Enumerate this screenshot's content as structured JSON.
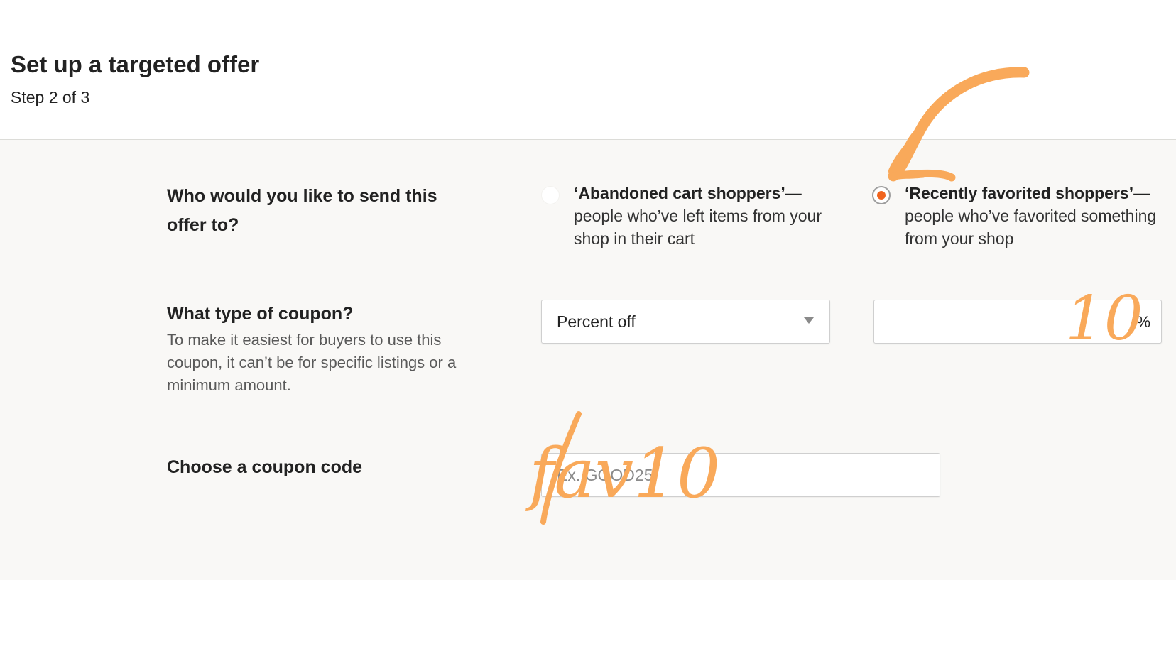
{
  "header": {
    "title": "Set up a targeted offer",
    "step": "Step 2 of 3"
  },
  "audience": {
    "question": "Who would you like to send this offer to?",
    "options": [
      {
        "title": "‘Abandoned cart shoppers’—",
        "description": "people who’ve left items from your shop in their cart",
        "selected": false
      },
      {
        "title": "‘Recently favorited shoppers’—",
        "description": "people who’ve favorited something from your shop",
        "selected": true
      }
    ]
  },
  "coupon_type": {
    "question": "What type of coupon?",
    "helper": "To make it easiest for buyers to use this coupon, it can’t be for specific listings or a minimum amount.",
    "select_value": "Percent off",
    "amount_value": "",
    "amount_suffix": "%"
  },
  "coupon_code": {
    "question": "Choose a coupon code",
    "value": "",
    "placeholder": "Ex. GOOD25"
  },
  "annotations": {
    "color": "#f9a95a",
    "amount_note": "10",
    "code_note": "fav10",
    "arrow_icon": "hand-drawn-arrow"
  },
  "colors": {
    "accent": "#f1641e",
    "panel_bg": "#f9f8f6",
    "annotation": "#f9a95a"
  }
}
